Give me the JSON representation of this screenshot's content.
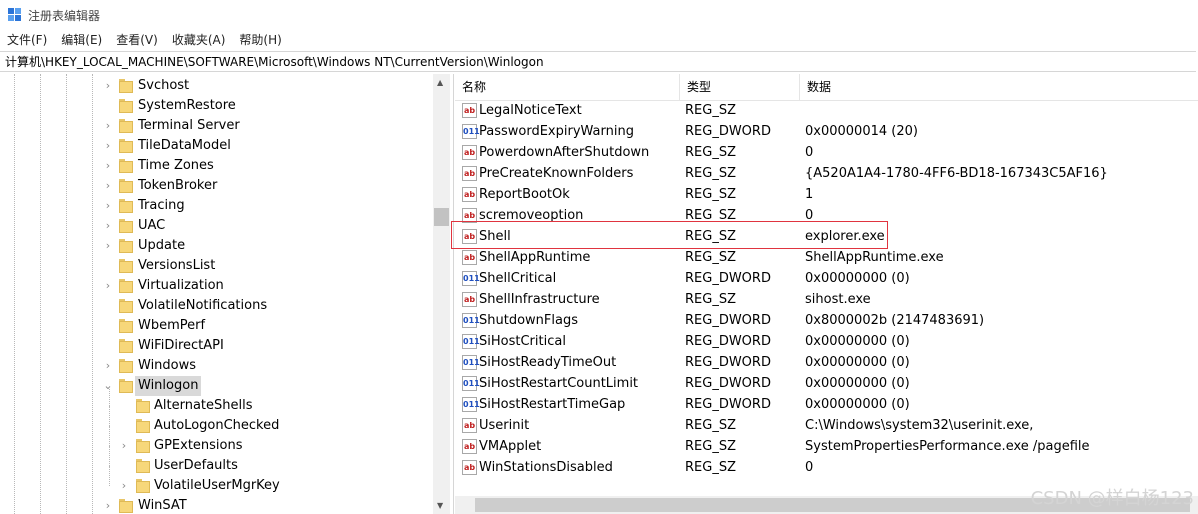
{
  "window": {
    "title": "注册表编辑器"
  },
  "menu": [
    "文件(F)",
    "编辑(E)",
    "查看(V)",
    "收藏夹(A)",
    "帮助(H)"
  ],
  "address": "计算机\\HKEY_LOCAL_MACHINE\\SOFTWARE\\Microsoft\\Windows NT\\CurrentVersion\\Winlogon",
  "tree": {
    "items": [
      {
        "label": "Svchost",
        "level": 0,
        "expander": ">"
      },
      {
        "label": "SystemRestore",
        "level": 0,
        "expander": ""
      },
      {
        "label": "Terminal Server",
        "level": 0,
        "expander": ">"
      },
      {
        "label": "TileDataModel",
        "level": 0,
        "expander": ">"
      },
      {
        "label": "Time Zones",
        "level": 0,
        "expander": ">"
      },
      {
        "label": "TokenBroker",
        "level": 0,
        "expander": ">"
      },
      {
        "label": "Tracing",
        "level": 0,
        "expander": ">"
      },
      {
        "label": "UAC",
        "level": 0,
        "expander": ">"
      },
      {
        "label": "Update",
        "level": 0,
        "expander": ">"
      },
      {
        "label": "VersionsList",
        "level": 0,
        "expander": ""
      },
      {
        "label": "Virtualization",
        "level": 0,
        "expander": ">"
      },
      {
        "label": "VolatileNotifications",
        "level": 0,
        "expander": ""
      },
      {
        "label": "WbemPerf",
        "level": 0,
        "expander": ""
      },
      {
        "label": "WiFiDirectAPI",
        "level": 0,
        "expander": ""
      },
      {
        "label": "Windows",
        "level": 0,
        "expander": ">"
      },
      {
        "label": "Winlogon",
        "level": 0,
        "expander": "v",
        "selected": true
      },
      {
        "label": "AlternateShells",
        "level": 1,
        "expander": ""
      },
      {
        "label": "AutoLogonChecked",
        "level": 1,
        "expander": ""
      },
      {
        "label": "GPExtensions",
        "level": 1,
        "expander": ">"
      },
      {
        "label": "UserDefaults",
        "level": 1,
        "expander": ""
      },
      {
        "label": "VolatileUserMgrKey",
        "level": 1,
        "expander": ">"
      },
      {
        "label": "WinSAT",
        "level": 0,
        "expander": ">"
      }
    ]
  },
  "columns": {
    "name": "名称",
    "type": "类型",
    "data": "数据"
  },
  "values": [
    {
      "name": "LegalNoticeText",
      "type": "REG_SZ",
      "data": "",
      "icon": "string-value-icon"
    },
    {
      "name": "PasswordExpiryWarning",
      "type": "REG_DWORD",
      "data": "0x00000014 (20)",
      "icon": "dword-value-icon"
    },
    {
      "name": "PowerdownAfterShutdown",
      "type": "REG_SZ",
      "data": "0",
      "icon": "string-value-icon"
    },
    {
      "name": "PreCreateKnownFolders",
      "type": "REG_SZ",
      "data": "{A520A1A4-1780-4FF6-BD18-167343C5AF16}",
      "icon": "string-value-icon"
    },
    {
      "name": "ReportBootOk",
      "type": "REG_SZ",
      "data": "1",
      "icon": "string-value-icon"
    },
    {
      "name": "scremoveoption",
      "type": "REG_SZ",
      "data": "0",
      "icon": "string-value-icon"
    },
    {
      "name": "Shell",
      "type": "REG_SZ",
      "data": "explorer.exe",
      "icon": "string-value-icon",
      "highlighted": true
    },
    {
      "name": "ShellAppRuntime",
      "type": "REG_SZ",
      "data": "ShellAppRuntime.exe",
      "icon": "string-value-icon"
    },
    {
      "name": "ShellCritical",
      "type": "REG_DWORD",
      "data": "0x00000000 (0)",
      "icon": "dword-value-icon"
    },
    {
      "name": "ShellInfrastructure",
      "type": "REG_SZ",
      "data": "sihost.exe",
      "icon": "string-value-icon"
    },
    {
      "name": "ShutdownFlags",
      "type": "REG_DWORD",
      "data": "0x8000002b (2147483691)",
      "icon": "dword-value-icon"
    },
    {
      "name": "SiHostCritical",
      "type": "REG_DWORD",
      "data": "0x00000000 (0)",
      "icon": "dword-value-icon"
    },
    {
      "name": "SiHostReadyTimeOut",
      "type": "REG_DWORD",
      "data": "0x00000000 (0)",
      "icon": "dword-value-icon"
    },
    {
      "name": "SiHostRestartCountLimit",
      "type": "REG_DWORD",
      "data": "0x00000000 (0)",
      "icon": "dword-value-icon"
    },
    {
      "name": "SiHostRestartTimeGap",
      "type": "REG_DWORD",
      "data": "0x00000000 (0)",
      "icon": "dword-value-icon"
    },
    {
      "name": "Userinit",
      "type": "REG_SZ",
      "data": "C:\\Windows\\system32\\userinit.exe,",
      "icon": "string-value-icon"
    },
    {
      "name": "VMApplet",
      "type": "REG_SZ",
      "data": "SystemPropertiesPerformance.exe /pagefile",
      "icon": "string-value-icon"
    },
    {
      "name": "WinStationsDisabled",
      "type": "REG_SZ",
      "data": "0",
      "icon": "string-value-icon"
    }
  ],
  "watermark": "CSDN @样白杨123",
  "colors": {
    "highlight_border": "#e0343f",
    "selection": "#d9d9d9",
    "folder": "#f7d77a"
  }
}
